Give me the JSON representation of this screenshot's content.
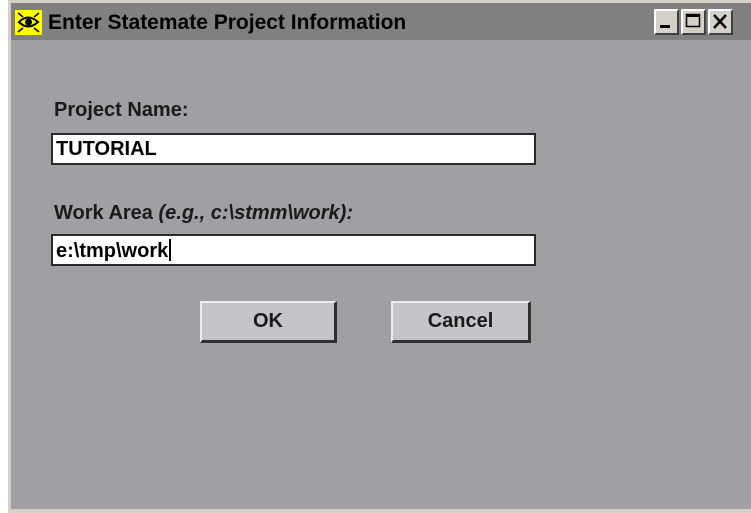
{
  "window": {
    "title": "Enter Statemate Project Information",
    "icon": "statemate-app-icon",
    "controls": {
      "minimize_icon": "minimize-icon",
      "maximize_icon": "maximize-icon",
      "close_icon": "close-icon"
    }
  },
  "form": {
    "project_name": {
      "label": "Project Name:",
      "value": "TUTORIAL"
    },
    "work_area": {
      "label": "Work Area",
      "hint": "(e.g., c:\\stmm\\work):",
      "value": "e:\\tmp\\work"
    }
  },
  "buttons": {
    "ok_label": "OK",
    "cancel_label": "Cancel"
  },
  "colors": {
    "dialog_background": "#a09fa3",
    "titlebar": "#808080",
    "button_face": "#c5c4c9",
    "icon_background": "#ffff00"
  }
}
